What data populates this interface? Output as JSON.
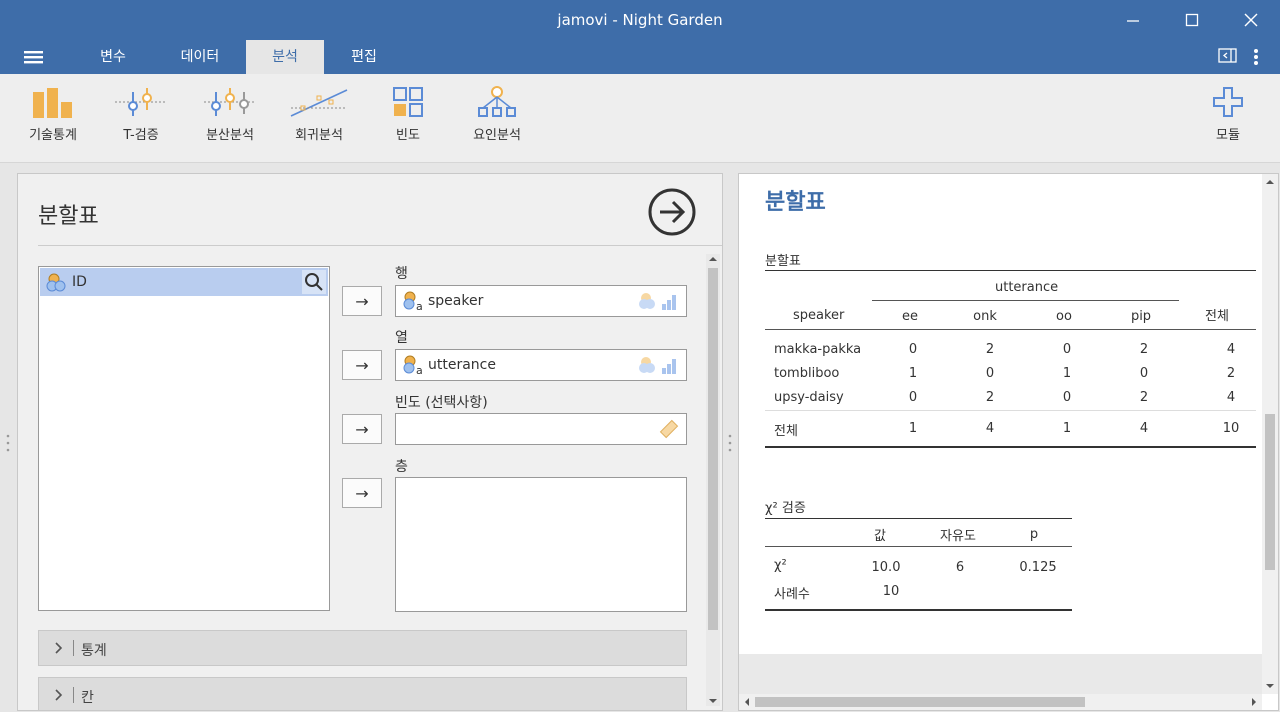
{
  "window": {
    "title": "jamovi - Night Garden"
  },
  "tabs": [
    {
      "label": "변수"
    },
    {
      "label": "데이터"
    },
    {
      "label": "분석",
      "active": true
    },
    {
      "label": "편집"
    }
  ],
  "ribbon": {
    "buttons": [
      {
        "label": "기술통계",
        "icon": "bar-chart-icon"
      },
      {
        "label": "T-검증",
        "icon": "t-test-icon"
      },
      {
        "label": "분산분석",
        "icon": "anova-icon"
      },
      {
        "label": "회귀분석",
        "icon": "regression-icon"
      },
      {
        "label": "빈도",
        "icon": "frequencies-icon"
      },
      {
        "label": "요인분석",
        "icon": "factor-icon"
      }
    ],
    "modules_label": "모듈"
  },
  "options": {
    "title": "분할표",
    "variables": [
      "ID"
    ],
    "targets": [
      {
        "label": "행",
        "value": "speaker"
      },
      {
        "label": "열",
        "value": "utterance"
      },
      {
        "label": "빈도 (선택사항)",
        "value": ""
      },
      {
        "label": "층",
        "value": ""
      }
    ],
    "sections": [
      "통계",
      "칸"
    ]
  },
  "results": {
    "heading": "분할표",
    "table_title": "분할표",
    "col_group": "utterance",
    "row_header": "speaker",
    "columns": [
      "ee",
      "onk",
      "oo",
      "pip"
    ],
    "total_label": "전체",
    "rows": [
      {
        "name": "makka-pakka",
        "values": [
          "0",
          "2",
          "0",
          "2"
        ],
        "total": "4"
      },
      {
        "name": "tombliboo",
        "values": [
          "1",
          "0",
          "1",
          "0"
        ],
        "total": "2"
      },
      {
        "name": "upsy-daisy",
        "values": [
          "0",
          "2",
          "0",
          "2"
        ],
        "total": "4"
      }
    ],
    "totals_row": {
      "name": "전체",
      "values": [
        "1",
        "4",
        "1",
        "4"
      ],
      "total": "10"
    },
    "chi_title": "χ² 검증",
    "chi_headers": [
      "값",
      "자유도",
      "p"
    ],
    "chi_rows": [
      {
        "name": "χ²",
        "value": "10.0",
        "df": "6",
        "p": "0.125"
      },
      {
        "name": "사례수",
        "value": "10",
        "df": "",
        "p": ""
      }
    ]
  },
  "colors": {
    "brand": "#3e6da9",
    "orange": "#f0b24e",
    "blue": "#5b8bd6"
  }
}
